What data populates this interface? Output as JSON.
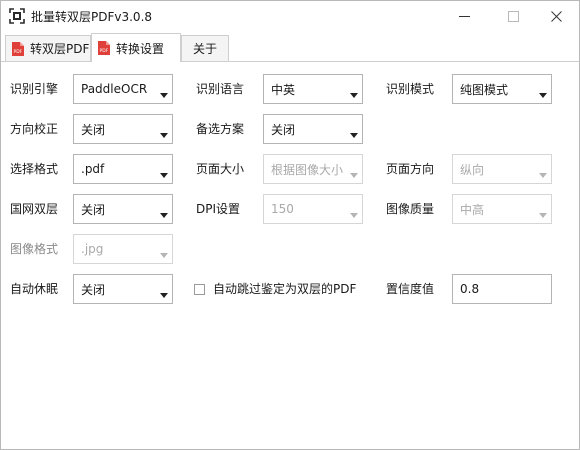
{
  "window": {
    "title": "批量转双层PDFv3.0.8",
    "icons": {
      "app": "scanner-app-icon",
      "minimize": "minimize-icon",
      "maximize": "maximize-icon",
      "close": "close-icon"
    }
  },
  "tabs": [
    {
      "label": "转双层PDF",
      "icon": "pdf-file-icon",
      "active": false
    },
    {
      "label": "转换设置",
      "icon": "pdf-file-icon",
      "active": true
    },
    {
      "label": "关于",
      "active": false
    }
  ],
  "settings": {
    "ocr_engine": {
      "label": "识别引擎",
      "value": "PaddleOCR"
    },
    "ocr_language": {
      "label": "识别语言",
      "value": "中英"
    },
    "ocr_mode": {
      "label": "识别模式",
      "value": "纯图模式"
    },
    "orientation_correction": {
      "label": "方向校正",
      "value": "关闭"
    },
    "fallback_plan": {
      "label": "备选方案",
      "value": "关闭"
    },
    "select_format": {
      "label": "选择格式",
      "value": ".pdf"
    },
    "page_size": {
      "label": "页面大小",
      "value": "根据图像大小",
      "disabled": true
    },
    "page_orientation": {
      "label": "页面方向",
      "value": "纵向",
      "disabled": true
    },
    "national_double_layer": {
      "label": "国网双层",
      "value": "关闭"
    },
    "dpi": {
      "label": "DPI设置",
      "value": "150",
      "disabled": true
    },
    "image_quality": {
      "label": "图像质量",
      "value": "中高",
      "disabled": true
    },
    "image_format": {
      "label": "图像格式",
      "value": ".jpg",
      "disabled": true
    },
    "auto_sleep": {
      "label": "自动休眠",
      "value": "关闭"
    },
    "skip_double_layer": {
      "label": "自动跳过鉴定为双层的PDF",
      "checked": false
    },
    "confidence": {
      "label": "置信度值",
      "value": "0.8"
    }
  },
  "colors": {
    "pdf_icon": "#e0403a",
    "disabled_text": "#a9a9a9",
    "border": "#b4b4b4"
  }
}
